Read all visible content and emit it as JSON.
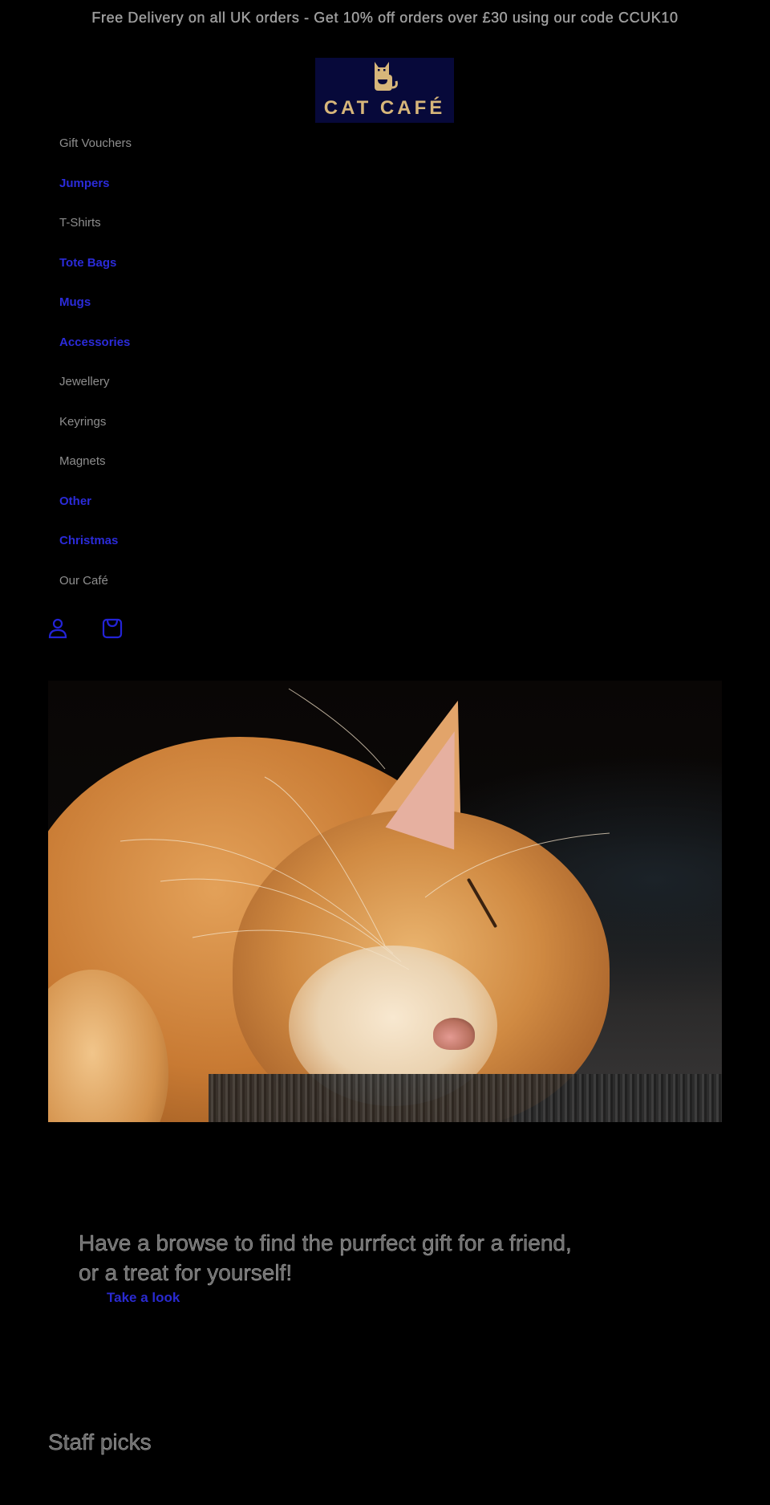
{
  "announcement": {
    "text": "Free Delivery on all UK orders - Get 10% off orders over £30 using our code CCUK10"
  },
  "brand": {
    "name": "CAT CAFÉ",
    "logo_icon": "cat-with-cup-icon",
    "colors": {
      "logo_background": "#07093a",
      "logo_foreground": "#d7b67a"
    }
  },
  "nav": {
    "items": [
      {
        "label": "Gift Vouchers",
        "style": "plain"
      },
      {
        "label": "Jumpers",
        "style": "link"
      },
      {
        "label": "T-Shirts",
        "style": "plain"
      },
      {
        "label": "Tote Bags",
        "style": "link"
      },
      {
        "label": "Mugs",
        "style": "link"
      },
      {
        "label": "Accessories",
        "style": "link"
      },
      {
        "label": "Jewellery",
        "style": "plain"
      },
      {
        "label": "Keyrings",
        "style": "plain"
      },
      {
        "label": "Magnets",
        "style": "plain"
      },
      {
        "label": "Other",
        "style": "link"
      },
      {
        "label": "Christmas",
        "style": "link"
      },
      {
        "label": "Our Café",
        "style": "plain"
      }
    ],
    "link_color": "#2b2bd9"
  },
  "header_icons": {
    "account": "account-icon",
    "cart": "cart-icon",
    "color": "#2323d6"
  },
  "hero": {
    "image_alt": "Ginger cat sleeping on a dark carpet"
  },
  "promo": {
    "text": "Have a browse to find the purrfect gift for a friend, or a treat for yourself!",
    "cta_label": "Take a look"
  },
  "featured": {
    "title": "Staff picks"
  }
}
